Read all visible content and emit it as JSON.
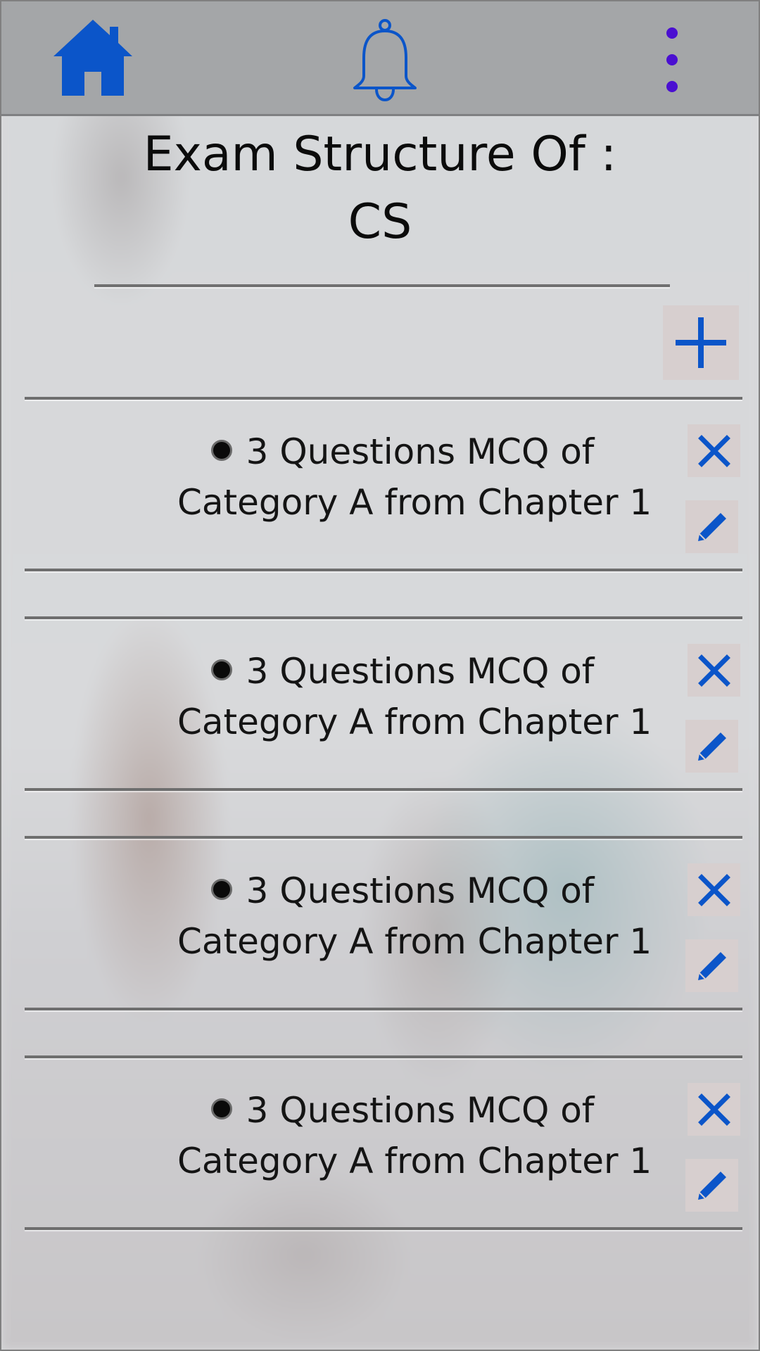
{
  "toolbar": {
    "home_icon": "home-icon",
    "notifications_icon": "bell-icon",
    "menu_icon": "more-vertical-icon"
  },
  "header": {
    "title_line1": "Exam Structure Of :",
    "title_line2": "CS"
  },
  "actions": {
    "add_icon": "plus-icon"
  },
  "items": [
    {
      "line1": "3 Questions MCQ of",
      "line2": "Category A from Chapter 1"
    },
    {
      "line1": "3 Questions MCQ of",
      "line2": "Category A from Chapter 1"
    },
    {
      "line1": "3 Questions MCQ of",
      "line2": "Category A from Chapter 1"
    },
    {
      "line1": "3 Questions MCQ of",
      "line2": "Category A from Chapter 1"
    }
  ],
  "colors": {
    "accent_blue": "#0b55c9",
    "menu_purple": "#4a0fd1",
    "topbar": "#a4a6a8",
    "button_bg": "#d7cfcf"
  }
}
